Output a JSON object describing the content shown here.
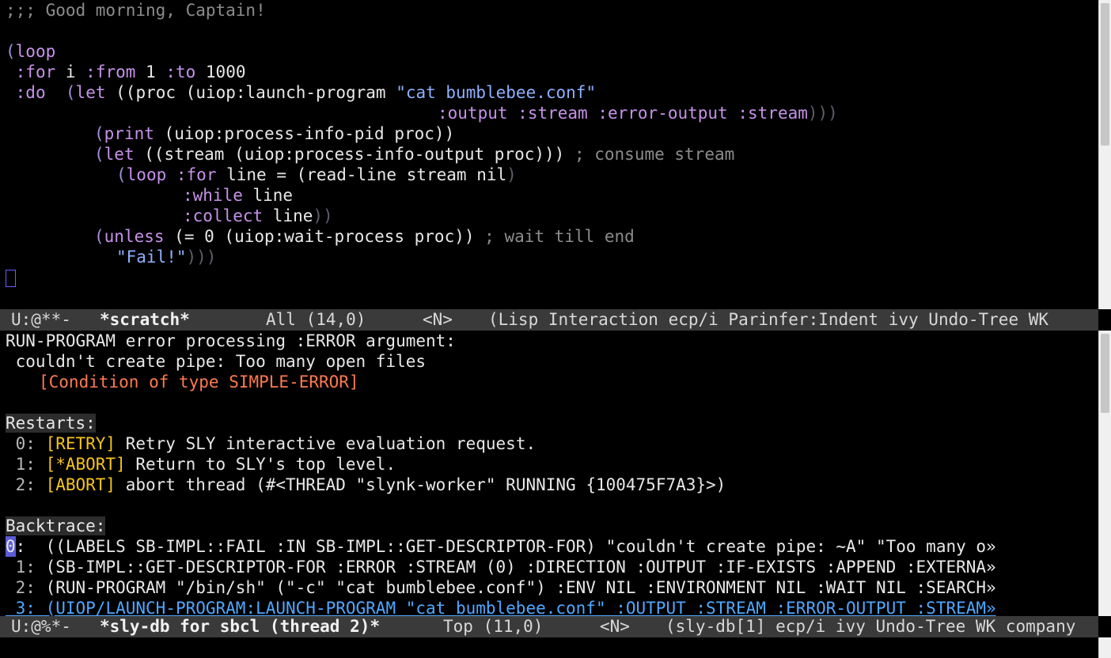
{
  "scratch": {
    "comment": ";;; Good morning, Captain!",
    "t_loop": "loop",
    "t_for": ":for",
    "t_i": " i ",
    "t_from": ":from",
    "t_1": " 1 ",
    "t_to": ":to",
    "t_1000": " 1000",
    "t_do": ":do",
    "t_let": "let",
    "t_proc": "proc",
    "t_launch": "uiop:launch-program",
    "t_cmd": "\"cat bumblebee.conf\"",
    "t_output": ":output",
    "t_stream": ":stream",
    "t_error_output": ":error-output",
    "t_print": "print",
    "t_pid": "uiop:process-info-pid proc",
    "t_stream_word": "stream",
    "t_pio": "uiop:process-info-output proc",
    "t_consume": "; consume stream",
    "t_line": " line = ",
    "t_readline": "read-line stream nil",
    "t_while": ":while",
    "t_line2": " line",
    "t_collect": ":collect",
    "t_unless": "unless",
    "t_eq": "= 0 ",
    "t_wait": "uiop:wait-process proc",
    "t_wait_comment": "; wait till end",
    "t_fail": "\"Fail!\""
  },
  "modeline_top": {
    "state": "U:@**-",
    "buffer": "*scratch*",
    "position": "All (14,0)",
    "evil": "<N>",
    "modes": "(Lisp Interaction ecp/i Parinfer:Indent ivy Undo-Tree WK"
  },
  "debugger": {
    "error_line1": "RUN-PROGRAM error processing :ERROR argument:",
    "error_line2": " couldn't create pipe: Too many open files",
    "condition": "[Condition of type SIMPLE-ERROR]",
    "restarts_label": "Restarts:",
    "restarts": [
      {
        "index": " 0: ",
        "tag": "[RETRY]",
        "text": " Retry SLY interactive evaluation request."
      },
      {
        "index": " 1: ",
        "tag": "[*ABORT]",
        "text": " Return to SLY's top level."
      },
      {
        "index": " 2: ",
        "tag": "[ABORT]",
        "text": " abort thread (#<THREAD \"slynk-worker\" RUNNING {100475F7A3}>)"
      }
    ],
    "backtrace_label": "Backtrace:",
    "frames": [
      {
        "index": "0",
        "text": ":  ((LABELS SB-IMPL::FAIL :IN SB-IMPL::GET-DESCRIPTOR-FOR) \"couldn't create pipe: ~A\" \"Too many o»"
      },
      {
        "index": " 1:",
        "text": " (SB-IMPL::GET-DESCRIPTOR-FOR :ERROR :STREAM (0) :DIRECTION :OUTPUT :IF-EXISTS :APPEND :EXTERNA»"
      },
      {
        "index": " 2:",
        "text": " (RUN-PROGRAM \"/bin/sh\" (\"-c\" \"cat bumblebee.conf\") :ENV NIL :ENVIRONMENT NIL :WAIT NIL :SEARCH»"
      },
      {
        "index": " 3:",
        "text": " (UIOP/LAUNCH-PROGRAM:LAUNCH-PROGRAM \"cat bumblebee.conf\" :OUTPUT :STREAM :ERROR-OUTPUT :STREAM»"
      }
    ]
  },
  "modeline_bottom": {
    "state": "U:@%*-",
    "buffer": "*sly-db for sbcl (thread 2)*",
    "position": "Top (11,0)",
    "evil": "<N>",
    "modes": "(sly-db[1] ecp/i ivy Undo-Tree WK company"
  }
}
